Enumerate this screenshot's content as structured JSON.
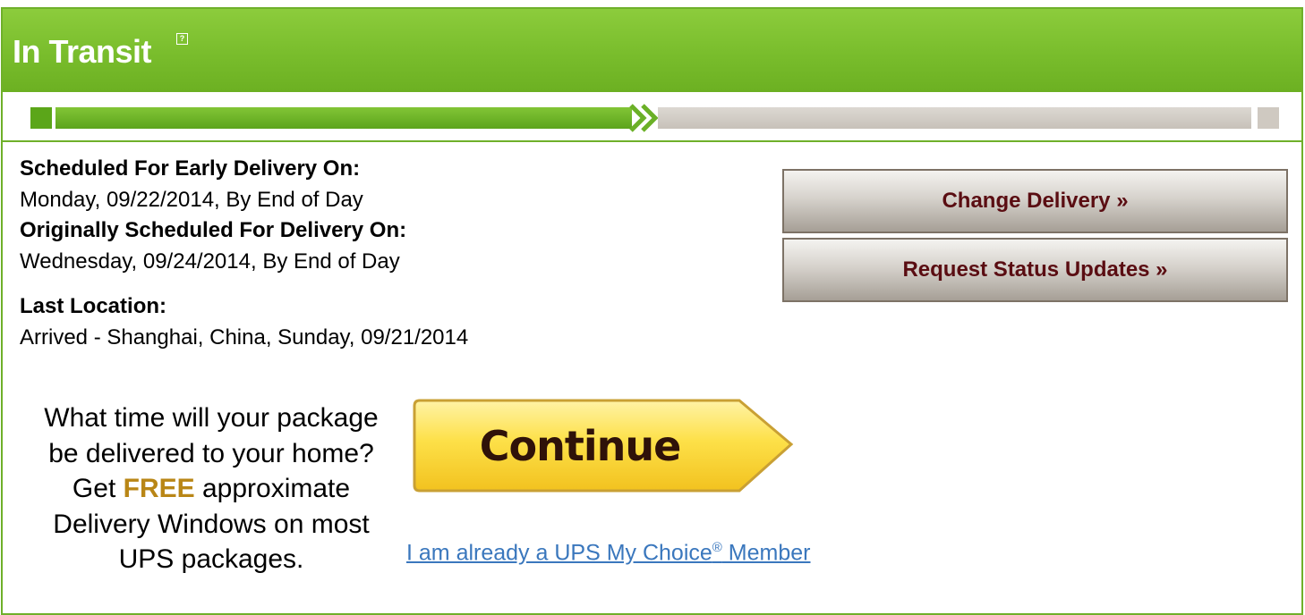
{
  "status": {
    "title": "In Transit",
    "help_icon": "question-mark-box-icon",
    "progress_fraction": 0.49
  },
  "colors": {
    "header_green": "#7ac02e",
    "progress_green": "#6bb027",
    "progress_gray": "#d3cdc6",
    "button_text": "#5a0d12",
    "free_accent": "#b98616",
    "link_blue": "#3a77bd",
    "continue_yellow": "#fdd837"
  },
  "details": {
    "early_label": "Scheduled For Early Delivery On:",
    "early_value": "Monday, 09/22/2014, By End of Day",
    "original_label": "Originally Scheduled For Delivery On:",
    "original_value": "Wednesday, 09/24/2014, By End of Day",
    "location_label": "Last Location:",
    "location_value": "Arrived - Shanghai, China, Sunday, 09/21/2014"
  },
  "actions": {
    "change_delivery": "Change Delivery »",
    "request_updates": "Request Status Updates »"
  },
  "promo": {
    "line1": "What time will your package",
    "line2": "be delivered to your home?",
    "get": "Get",
    "free": "FREE",
    "approximate": "approximate",
    "line4": "Delivery Windows on most",
    "line5": "UPS packages.",
    "continue_label": "Continue",
    "member_link_pre": "I am already a UPS My Choice",
    "member_link_reg": "®",
    "member_link_post": " Member"
  }
}
